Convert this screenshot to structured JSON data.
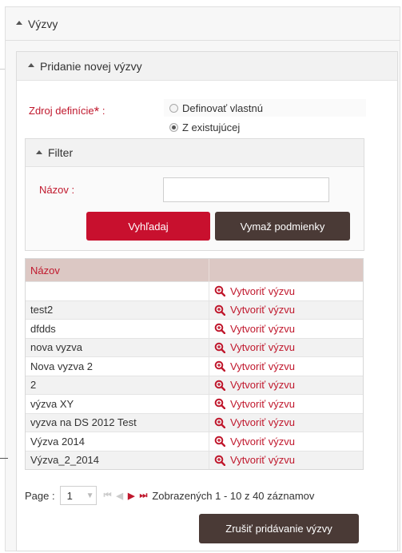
{
  "outer_panel": {
    "title": "Výzvy"
  },
  "inner_panel": {
    "title": "Pridanie novej výzvy"
  },
  "source": {
    "label": "Zdroj definície",
    "required_mark": "*",
    "colon": ":",
    "options": [
      {
        "label": "Definovať vlastnú",
        "checked": false
      },
      {
        "label": "Z existujúcej",
        "checked": true
      }
    ]
  },
  "filter": {
    "title": "Filter",
    "name_label": "Názov :",
    "name_value": "",
    "search_button": "Vyhľadaj",
    "clear_button": "Vymaž podmienky"
  },
  "grid": {
    "header": "Názov",
    "action_label": "Vytvoriť výzvu",
    "rows": [
      "",
      "test2",
      "dfdds",
      "nova vyzva",
      "Nova vyzva 2",
      "2",
      "výzva XY",
      "vyzva na DS 2012 Test",
      "Výzva 2014",
      "Výzva_2_2014"
    ]
  },
  "pager": {
    "page_label": "Page :",
    "page_value": "1",
    "summary": "Zobrazených 1 - 10 z 40 záznamov"
  },
  "cancel_button": "Zrušiť pridávanie výzvy",
  "colors": {
    "accent_red": "#c8102e",
    "dark_button": "#4a3a36",
    "grid_header": "#dcc8c4"
  }
}
